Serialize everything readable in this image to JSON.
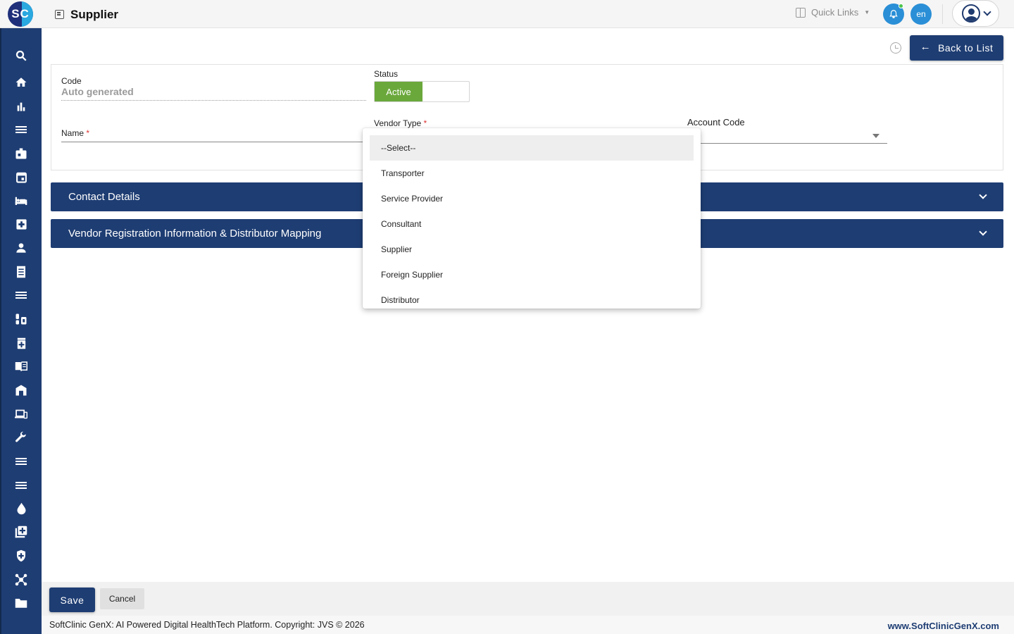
{
  "app": {
    "logo_text": "SC",
    "page_title": "Supplier",
    "quick_links": "Quick Links",
    "language": "en"
  },
  "sidebar": {
    "icons": [
      "search-icon",
      "home-icon",
      "bar-chart-icon",
      "menu-icon",
      "badge-icon",
      "calendar-icon",
      "bed-icon",
      "medical-plus-icon",
      "person-icon",
      "receipt-icon",
      "menu-icon",
      "pharmacy-icon",
      "medicine-box-icon",
      "book-icon",
      "store-icon",
      "devices-icon",
      "wrench-icon",
      "menu-icon",
      "menu-icon",
      "drop-icon",
      "add-library-icon",
      "shield-plus-icon",
      "hub-icon",
      "folder-icon"
    ]
  },
  "header_actions": {
    "back_label": "Back to List"
  },
  "form": {
    "code_label": "Code",
    "code_value": "Auto generated",
    "status_label": "Status",
    "status_value": "Active",
    "name_label": "Name",
    "vendor_type_label": "Vendor Type",
    "account_code_label": "Account Code",
    "required_marker": "*"
  },
  "sections": [
    {
      "label": "Contact Details"
    },
    {
      "label": "Vendor Registration Information & Distributor Mapping"
    }
  ],
  "vendor_type_dropdown": {
    "options": [
      "--Select--",
      "Transporter",
      "Service Provider",
      "Consultant",
      "Supplier",
      "Foreign Supplier",
      "Distributor"
    ],
    "selected_index": 0
  },
  "actions": {
    "save_label": "Save",
    "cancel_label": "Cancel"
  },
  "footer": {
    "copyright": "SoftClinic GenX: AI Powered Digital HealthTech Platform. Copyright: JVS © 2026",
    "site": "www.SoftClinicGenX.com"
  },
  "colors": {
    "primary": "#1e3d73",
    "active_green": "#6aa83b",
    "notification_blue": "#2a8fd6"
  }
}
